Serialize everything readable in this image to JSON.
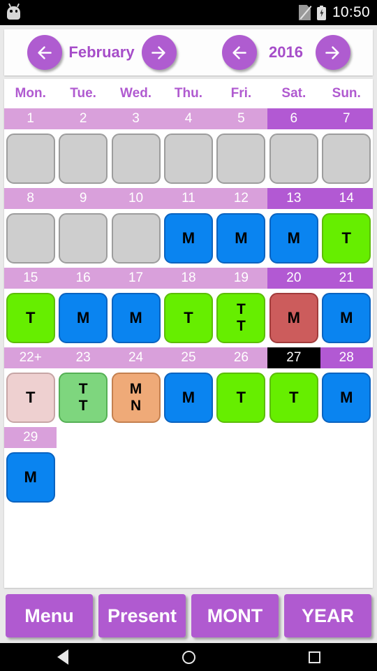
{
  "statusbar": {
    "time": "10:50",
    "app_icon": "android-robot-icon",
    "sim_icon": "no-sim-icon",
    "battery_icon": "battery-charging-icon"
  },
  "header": {
    "month_prev_label": "←",
    "month": "February",
    "month_next_label": "→",
    "year_prev_label": "←",
    "year": "2016",
    "year_next_label": "→"
  },
  "calendar": {
    "weekdays": [
      "Mon.",
      "Tue.",
      "Wed.",
      "Thu.",
      "Fri.",
      "Sat.",
      "Sun."
    ],
    "weeks": [
      {
        "days": [
          {
            "num": "1",
            "weekend": false,
            "today": false,
            "style": "empty",
            "marks": []
          },
          {
            "num": "2",
            "weekend": false,
            "today": false,
            "style": "empty",
            "marks": []
          },
          {
            "num": "3",
            "weekend": false,
            "today": false,
            "style": "empty",
            "marks": []
          },
          {
            "num": "4",
            "weekend": false,
            "today": false,
            "style": "empty",
            "marks": []
          },
          {
            "num": "5",
            "weekend": false,
            "today": false,
            "style": "empty",
            "marks": []
          },
          {
            "num": "6",
            "weekend": true,
            "today": false,
            "style": "empty",
            "marks": []
          },
          {
            "num": "7",
            "weekend": true,
            "today": false,
            "style": "empty",
            "marks": []
          }
        ]
      },
      {
        "days": [
          {
            "num": "8",
            "weekend": false,
            "today": false,
            "style": "empty",
            "marks": []
          },
          {
            "num": "9",
            "weekend": false,
            "today": false,
            "style": "empty",
            "marks": []
          },
          {
            "num": "10",
            "weekend": false,
            "today": false,
            "style": "empty",
            "marks": []
          },
          {
            "num": "11",
            "weekend": false,
            "today": false,
            "style": "blue",
            "marks": [
              "M"
            ]
          },
          {
            "num": "12",
            "weekend": false,
            "today": false,
            "style": "blue",
            "marks": [
              "M"
            ]
          },
          {
            "num": "13",
            "weekend": true,
            "today": false,
            "style": "blue",
            "marks": [
              "M"
            ]
          },
          {
            "num": "14",
            "weekend": true,
            "today": false,
            "style": "green",
            "marks": [
              "T"
            ]
          }
        ]
      },
      {
        "days": [
          {
            "num": "15",
            "weekend": false,
            "today": false,
            "style": "green",
            "marks": [
              "T"
            ]
          },
          {
            "num": "16",
            "weekend": false,
            "today": false,
            "style": "blue",
            "marks": [
              "M"
            ]
          },
          {
            "num": "17",
            "weekend": false,
            "today": false,
            "style": "blue",
            "marks": [
              "M"
            ]
          },
          {
            "num": "18",
            "weekend": false,
            "today": false,
            "style": "green",
            "marks": [
              "T"
            ]
          },
          {
            "num": "19",
            "weekend": false,
            "today": false,
            "style": "green",
            "marks": [
              "T",
              "T"
            ]
          },
          {
            "num": "20",
            "weekend": true,
            "today": false,
            "style": "red",
            "marks": [
              "M"
            ]
          },
          {
            "num": "21",
            "weekend": true,
            "today": false,
            "style": "blue",
            "marks": [
              "M"
            ]
          }
        ]
      },
      {
        "days": [
          {
            "num": "22+",
            "weekend": false,
            "today": false,
            "style": "pink",
            "marks": [
              "T"
            ]
          },
          {
            "num": "23",
            "weekend": false,
            "today": false,
            "style": "mgreen",
            "marks": [
              "T",
              "T"
            ]
          },
          {
            "num": "24",
            "weekend": false,
            "today": false,
            "style": "orange",
            "marks": [
              "M",
              "N"
            ]
          },
          {
            "num": "25",
            "weekend": false,
            "today": false,
            "style": "blue",
            "marks": [
              "M"
            ]
          },
          {
            "num": "26",
            "weekend": false,
            "today": false,
            "style": "green",
            "marks": [
              "T"
            ]
          },
          {
            "num": "27",
            "weekend": true,
            "today": true,
            "style": "green",
            "marks": [
              "T"
            ]
          },
          {
            "num": "28",
            "weekend": true,
            "today": false,
            "style": "blue",
            "marks": [
              "M"
            ]
          }
        ]
      },
      {
        "days": [
          {
            "num": "29",
            "weekend": false,
            "today": false,
            "style": "blue",
            "marks": [
              "M"
            ]
          },
          {
            "num": "",
            "weekend": false,
            "today": false,
            "style": "none",
            "marks": []
          },
          {
            "num": "",
            "weekend": false,
            "today": false,
            "style": "none",
            "marks": []
          },
          {
            "num": "",
            "weekend": false,
            "today": false,
            "style": "none",
            "marks": []
          },
          {
            "num": "",
            "weekend": false,
            "today": false,
            "style": "none",
            "marks": []
          },
          {
            "num": "",
            "weekend": true,
            "today": false,
            "style": "none",
            "marks": []
          },
          {
            "num": "",
            "weekend": true,
            "today": false,
            "style": "none",
            "marks": []
          }
        ]
      }
    ]
  },
  "buttons": {
    "menu": "Menu",
    "present": "Present",
    "month": "MONT",
    "year": "YEAR"
  },
  "navbar": {
    "back": "back-icon",
    "home": "home-icon",
    "recents": "recents-icon"
  },
  "colors": {
    "accent_purple": "#b05ad0",
    "header_weekday": "#d9a0db",
    "header_weekend": "#b259d3",
    "blue": "#0a84f0",
    "green": "#66ee00",
    "red": "#cc5c5c",
    "pink": "#eed0d0",
    "mid_green": "#7ed67e",
    "orange": "#efaa78",
    "empty_gray": "#cecece"
  }
}
